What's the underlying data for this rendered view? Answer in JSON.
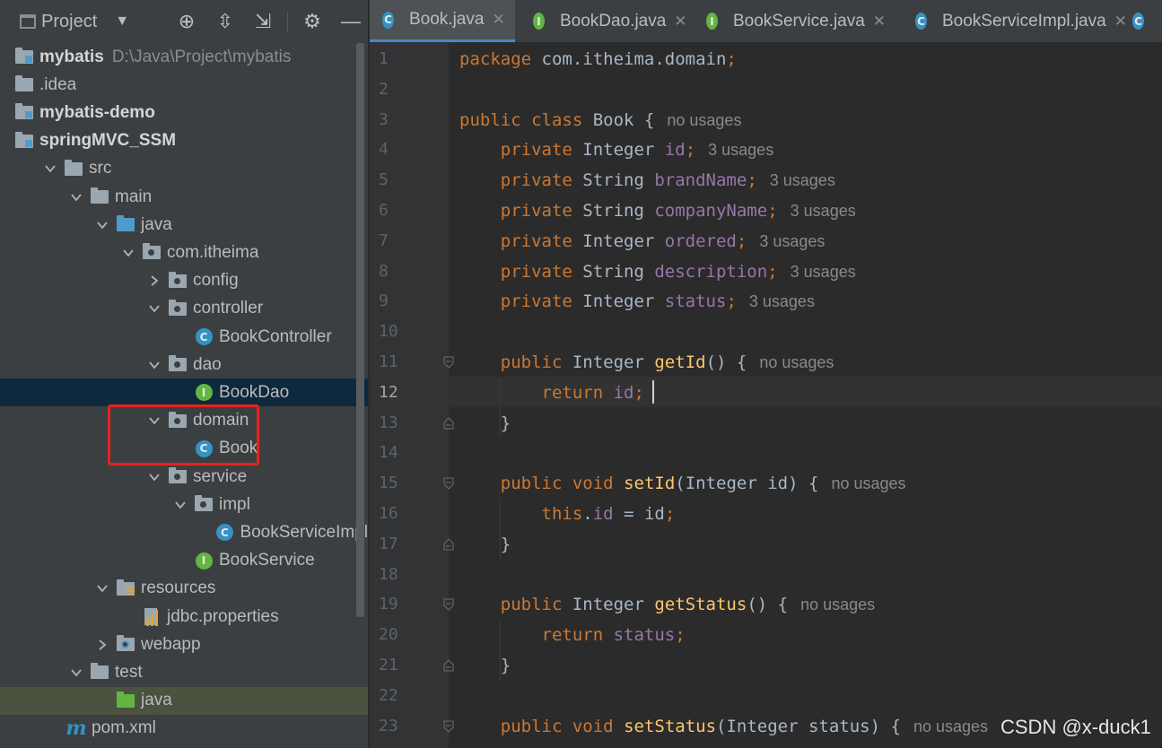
{
  "project_panel": {
    "title": "Project",
    "tree": [
      {
        "label": "mybatis",
        "path": "D:\\Java\\Project\\mybatis",
        "bold": true,
        "icon": "module-folder-icon"
      },
      {
        "label": ".idea",
        "icon": "folder-icon"
      },
      {
        "label": "mybatis-demo",
        "bold": true,
        "icon": "module-folder-icon"
      },
      {
        "label": "springMVC_SSM",
        "bold": true,
        "icon": "module-folder-icon"
      },
      {
        "label": "src",
        "icon": "folder-icon",
        "expanded": true
      },
      {
        "label": "main",
        "icon": "folder-icon",
        "expanded": true
      },
      {
        "label": "java",
        "icon": "source-folder-icon",
        "expanded": true
      },
      {
        "label": "com.itheima",
        "icon": "package-icon",
        "expanded": true
      },
      {
        "label": "config",
        "icon": "package-icon",
        "expanded": false
      },
      {
        "label": "controller",
        "icon": "package-icon",
        "expanded": true
      },
      {
        "label": "BookController",
        "icon": "class-icon"
      },
      {
        "label": "dao",
        "icon": "package-icon",
        "expanded": true
      },
      {
        "label": "BookDao",
        "icon": "interface-icon",
        "selected": true
      },
      {
        "label": "domain",
        "icon": "package-icon",
        "expanded": true
      },
      {
        "label": "Book",
        "icon": "class-icon"
      },
      {
        "label": "service",
        "icon": "package-icon",
        "expanded": true
      },
      {
        "label": "impl",
        "icon": "package-icon",
        "expanded": true
      },
      {
        "label": "BookServiceImpl",
        "icon": "class-icon"
      },
      {
        "label": "BookService",
        "icon": "interface-icon"
      },
      {
        "label": "resources",
        "icon": "resources-folder-icon",
        "expanded": true
      },
      {
        "label": "jdbc.properties",
        "icon": "properties-file-icon"
      },
      {
        "label": "webapp",
        "icon": "web-folder-icon",
        "expanded": false
      },
      {
        "label": "test",
        "icon": "folder-icon",
        "expanded": true
      },
      {
        "label": "java",
        "icon": "test-source-folder-icon"
      },
      {
        "label": "pom.xml",
        "icon": "maven-icon"
      }
    ]
  },
  "tabs": [
    {
      "label": "Book.java",
      "icon": "class-icon",
      "active": true
    },
    {
      "label": "BookDao.java",
      "icon": "interface-icon"
    },
    {
      "label": "BookService.java",
      "icon": "interface-icon"
    },
    {
      "label": "BookServiceImpl.java",
      "icon": "class-icon"
    }
  ],
  "editor": {
    "current_line": 12,
    "lines": [
      {
        "n": "1",
        "code": "package com.itheima.domain;"
      },
      {
        "n": "2",
        "code": ""
      },
      {
        "n": "3",
        "code": "public class Book {",
        "hint": "no usages"
      },
      {
        "n": "4",
        "code": "    private Integer id;",
        "hint": "3 usages"
      },
      {
        "n": "5",
        "code": "    private String brandName;",
        "hint": "3 usages"
      },
      {
        "n": "6",
        "code": "    private String companyName;",
        "hint": "3 usages"
      },
      {
        "n": "7",
        "code": "    private Integer ordered;",
        "hint": "3 usages"
      },
      {
        "n": "8",
        "code": "    private String description;",
        "hint": "3 usages"
      },
      {
        "n": "9",
        "code": "    private Integer status;",
        "hint": "3 usages"
      },
      {
        "n": "10",
        "code": ""
      },
      {
        "n": "11",
        "code": "    public Integer getId() {",
        "hint": "no usages"
      },
      {
        "n": "12",
        "code": "        return id;"
      },
      {
        "n": "13",
        "code": "    }"
      },
      {
        "n": "14",
        "code": ""
      },
      {
        "n": "15",
        "code": "    public void setId(Integer id) {",
        "hint": "no usages"
      },
      {
        "n": "16",
        "code": "        this.id = id;"
      },
      {
        "n": "17",
        "code": "    }"
      },
      {
        "n": "18",
        "code": ""
      },
      {
        "n": "19",
        "code": "    public Integer getStatus() {",
        "hint": "no usages"
      },
      {
        "n": "20",
        "code": "        return status;"
      },
      {
        "n": "21",
        "code": "    }"
      },
      {
        "n": "22",
        "code": ""
      },
      {
        "n": "23",
        "code": "    public void setStatus(Integer status) {",
        "hint": "no usages"
      }
    ]
  },
  "watermark": "CSDN @x-duck1",
  "colors": {
    "keyword": "#cc7832",
    "field": "#9876aa",
    "method": "#ffc66d",
    "text": "#a9b7c6",
    "highlight_box": "#e8211c"
  }
}
